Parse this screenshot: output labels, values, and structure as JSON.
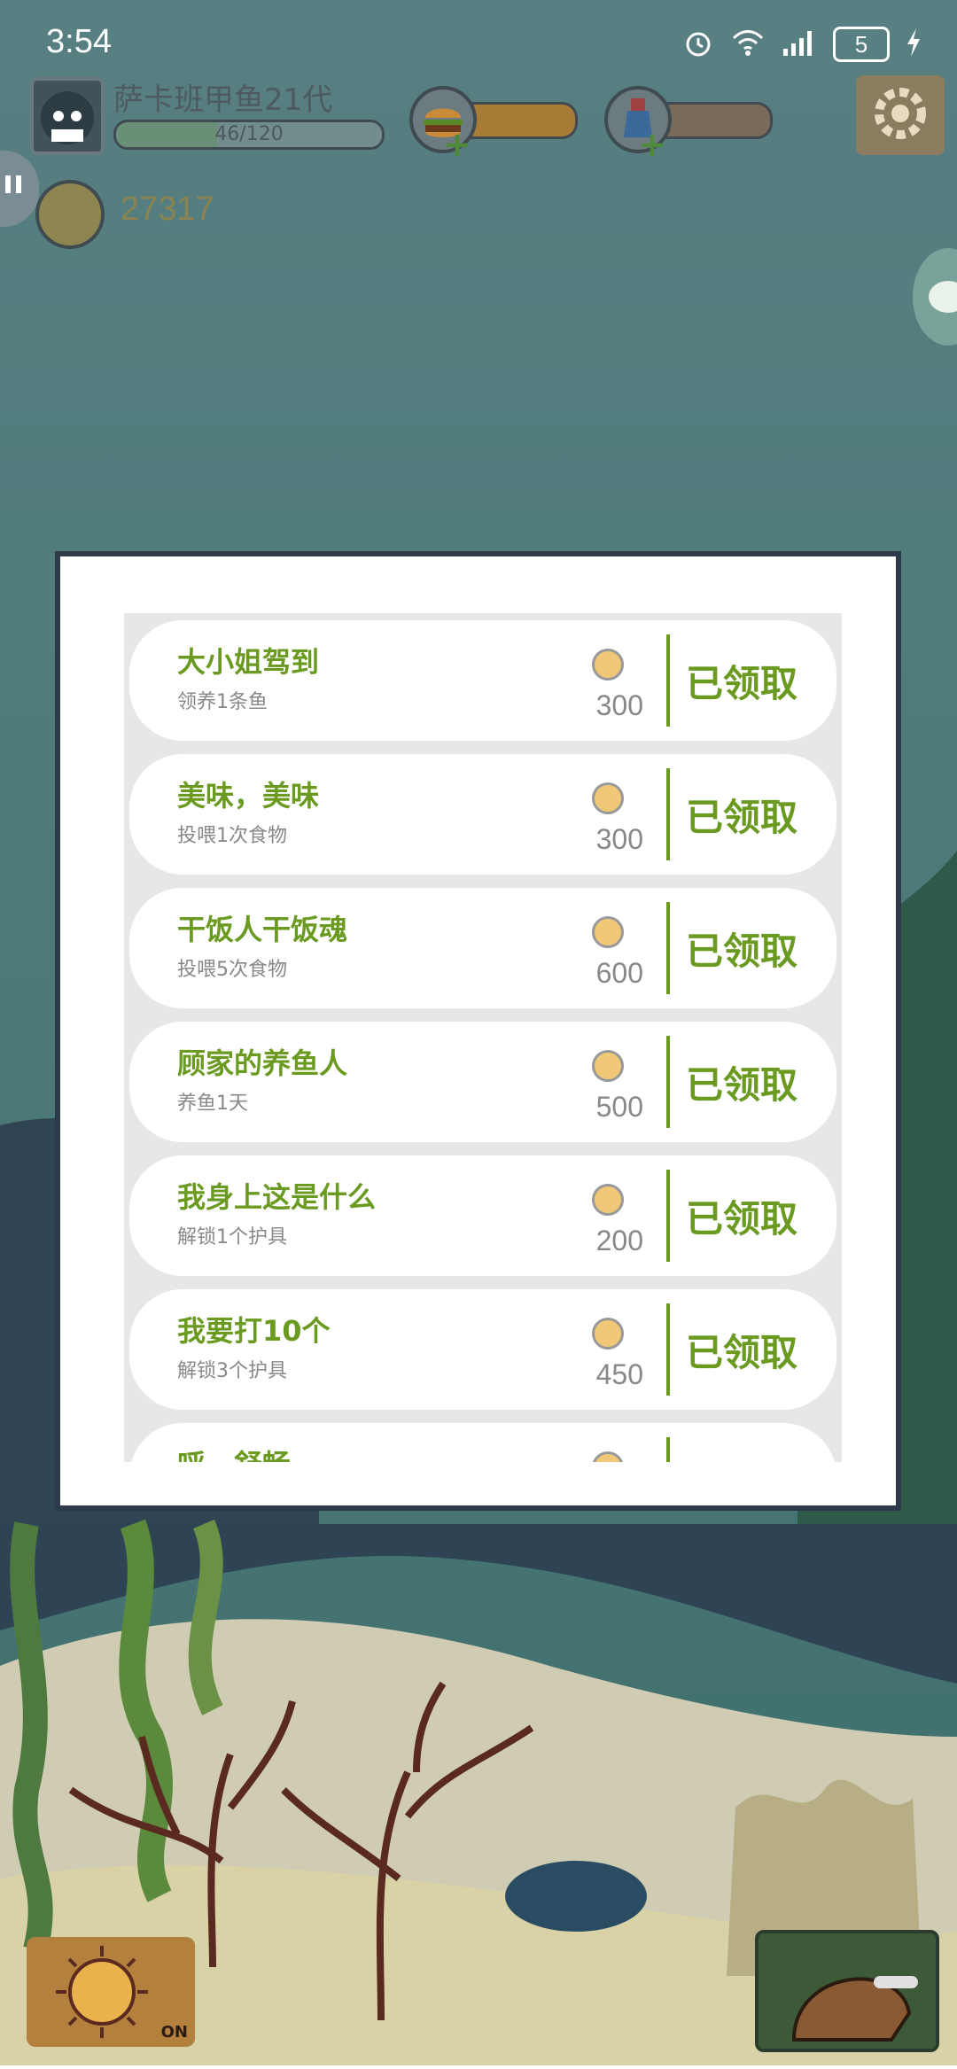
{
  "status": {
    "time": "3:54",
    "battery": "5"
  },
  "hud": {
    "fish_name": "萨卡班甲鱼21代",
    "xp_text": "46/120",
    "coins": "27317"
  },
  "icons": {
    "alarm": "alarm-icon",
    "wifi": "wifi-icon",
    "signal": "signal-icon",
    "food": "burger-icon",
    "potion": "potion-icon",
    "settings": "gear-icon",
    "chat": "chat-icon",
    "sun": "sun-icon",
    "helmet": "helmet-icon"
  },
  "sun_toggle_label": "ON",
  "achievements": [
    {
      "title": "大小姐驾到",
      "desc": "领养1条鱼",
      "reward": "300",
      "status": "已领取"
    },
    {
      "title": "美味，美味",
      "desc": "投喂1次食物",
      "reward": "300",
      "status": "已领取"
    },
    {
      "title": "干饭人干饭魂",
      "desc": "投喂5次食物",
      "reward": "600",
      "status": "已领取"
    },
    {
      "title": "顾家的养鱼人",
      "desc": "养鱼1天",
      "reward": "500",
      "status": "已领取"
    },
    {
      "title": "我身上这是什么",
      "desc": "解锁1个护具",
      "reward": "200",
      "status": "已领取"
    },
    {
      "title": "我要打10个",
      "desc": "解锁3个护具",
      "reward": "450",
      "status": "已领取"
    },
    {
      "title": "呼，舒畅",
      "desc": "",
      "reward": "",
      "status": ""
    }
  ],
  "colors": {
    "accent": "#6a9a20",
    "water_top": "#5c7f7f",
    "water_mid": "#4f7a78",
    "sand": "#d8d2b6"
  }
}
